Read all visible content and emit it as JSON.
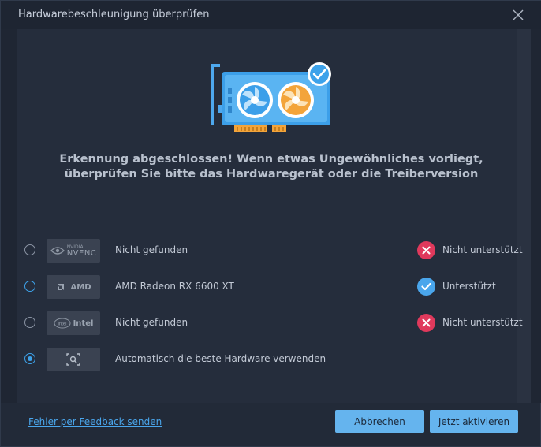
{
  "dialog": {
    "title": "Hardwarebeschleunigung überprüfen",
    "message": "Erkennung abgeschlossen! Wenn etwas Ungewöhnliches vorliegt, überprüfen Sie bitte das Hardwaregerät oder die Treiberversion"
  },
  "hardware_rows": [
    {
      "badge": {
        "small": "NVIDIA",
        "big": "NVENC",
        "icon": "nvidia-icon"
      },
      "label": "Nicht gefunden",
      "status": "Nicht unterstützt",
      "status_icon": "error-x-icon",
      "selected": false
    },
    {
      "badge": {
        "text": "AMD",
        "icon": "amd-icon"
      },
      "label": "AMD Radeon RX 6600 XT",
      "status": "Unterstützt",
      "status_icon": "check-icon",
      "selected": false
    },
    {
      "badge": {
        "text": "Intel",
        "icon": "intel-icon"
      },
      "label": "Nicht gefunden",
      "status": "Nicht unterstützt",
      "status_icon": "error-x-icon",
      "selected": false
    },
    {
      "badge": {
        "icon": "auto-detect-icon"
      },
      "label": "Automatisch die beste Hardware verwenden",
      "selected": true
    }
  ],
  "footer": {
    "feedback_link": "Fehler per Feedback senden",
    "cancel_label": "Abbrechen",
    "activate_label": "Jetzt aktivieren"
  },
  "colors": {
    "accent": "#4aa6ec",
    "error": "#e0395c",
    "button_bg": "#65b4ee",
    "dialog_bg": "#222a38"
  }
}
